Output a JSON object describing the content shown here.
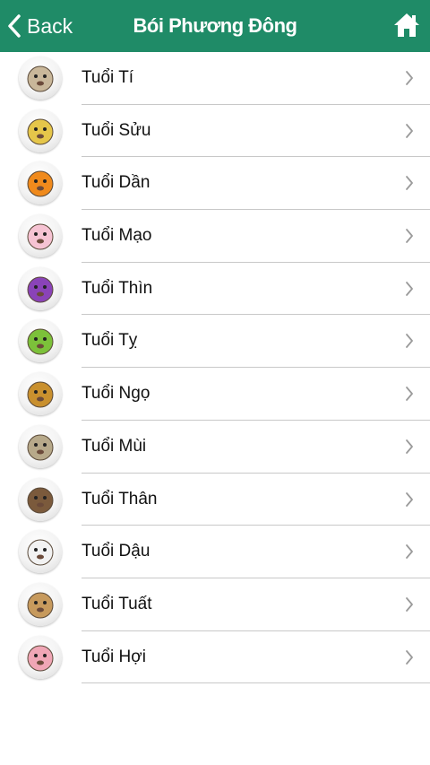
{
  "header": {
    "back_label": "Back",
    "title": "Bói Phương Đông"
  },
  "accent_color": "#1f8b67",
  "items": [
    {
      "label": "Tuổi Tí",
      "icon": "rat-icon",
      "color": "#c9b79a"
    },
    {
      "label": "Tuổi Sửu",
      "icon": "ox-icon",
      "color": "#e5c64a"
    },
    {
      "label": "Tuổi Dần",
      "icon": "tiger-icon",
      "color": "#f08a1c"
    },
    {
      "label": "Tuổi Mạo",
      "icon": "cat-icon",
      "color": "#f6c3d3"
    },
    {
      "label": "Tuổi Thìn",
      "icon": "dragon-icon",
      "color": "#8a43b8"
    },
    {
      "label": "Tuổi Tỵ",
      "icon": "snake-icon",
      "color": "#7cc13a"
    },
    {
      "label": "Tuổi Ngọ",
      "icon": "horse-icon",
      "color": "#c9902e"
    },
    {
      "label": "Tuổi Mùi",
      "icon": "goat-icon",
      "color": "#b7a98a"
    },
    {
      "label": "Tuổi Thân",
      "icon": "monkey-icon",
      "color": "#7b5a3c"
    },
    {
      "label": "Tuổi Dậu",
      "icon": "rooster-icon",
      "color": "#f2f2f2"
    },
    {
      "label": "Tuổi Tuất",
      "icon": "dog-icon",
      "color": "#c79a5d"
    },
    {
      "label": "Tuổi Hợi",
      "icon": "pig-icon",
      "color": "#f0a6b6"
    }
  ]
}
